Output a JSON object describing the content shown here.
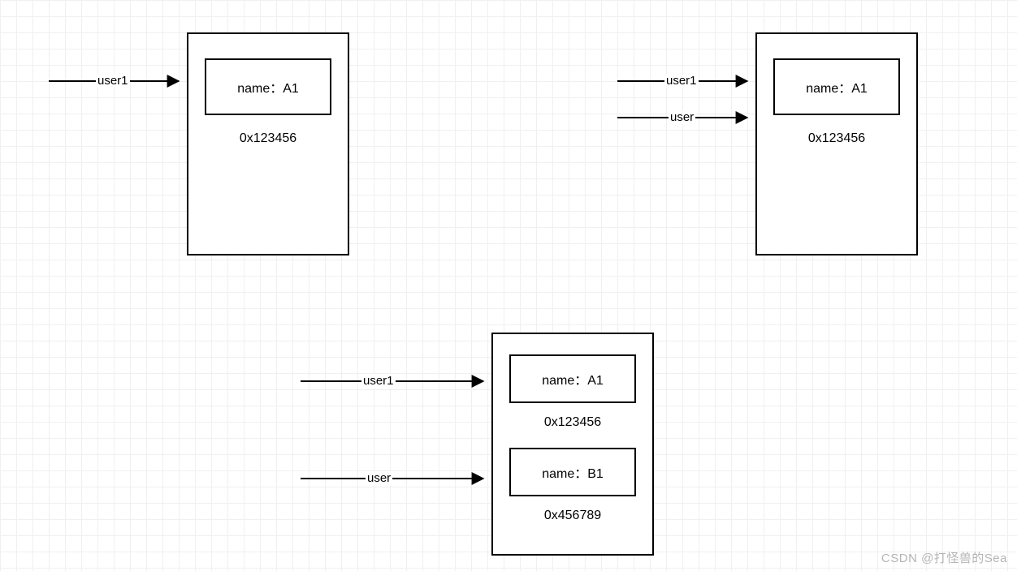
{
  "diagram1": {
    "pointer1": "user1",
    "name_label": "name：A1",
    "address": "0x123456"
  },
  "diagram2": {
    "pointer1": "user1",
    "pointer2": "user",
    "name_label": "name：A1",
    "address": "0x123456"
  },
  "diagram3": {
    "pointer1": "user1",
    "pointer2": "user",
    "name_label1": "name：A1",
    "address1": "0x123456",
    "name_label2": "name：B1",
    "address2": "0x456789"
  },
  "watermark": "CSDN @打怪兽的Sea"
}
